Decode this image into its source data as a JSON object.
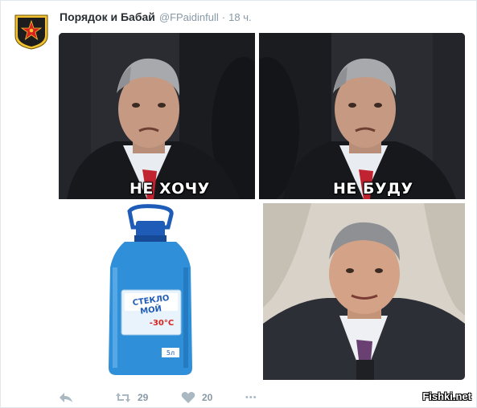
{
  "tweet": {
    "author_name": "Порядок и Бабай",
    "author_handle": "@FPaidinfull",
    "separator": "·",
    "time": "18 ч.",
    "avatar_icon": "soviet-star-emblem-icon"
  },
  "media": {
    "panels": [
      {
        "caption": "НЕ ХОЧУ",
        "scene": "frowning-man-in-suit"
      },
      {
        "caption": "НЕ БУДУ",
        "scene": "frowning-man-in-suit"
      },
      {
        "label_top": "СТЕКЛО",
        "label_bottom": "МОЙ",
        "temp": "-30°С",
        "volume": "5л",
        "scene": "washer-fluid-bottle"
      },
      {
        "scene": "smiling-man-in-suit"
      }
    ]
  },
  "actions": {
    "reply_icon": "reply-icon",
    "retweet_icon": "retweet-icon",
    "retweet_count": "29",
    "like_icon": "heart-icon",
    "like_count": "20",
    "more_icon": "more-icon",
    "more_label": "•••"
  },
  "watermark": "Fishki.net",
  "colors": {
    "name": "#292f33",
    "muted": "#8899a6",
    "icon": "#aab8c2",
    "border": "#e1e8ed",
    "bottle_blue": "#2f8fd8",
    "cap_blue": "#1f5cb8"
  }
}
